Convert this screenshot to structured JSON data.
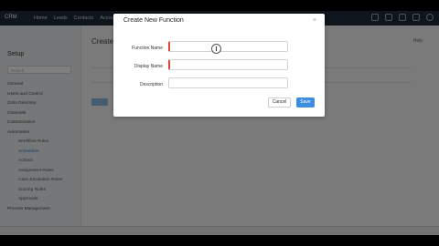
{
  "app": {
    "brand": "CRM",
    "nav": [
      "Home",
      "Leads",
      "Contacts",
      "Accounts"
    ]
  },
  "colors": {
    "accent": "#3d8ee0",
    "topbar": "#1c2a3a",
    "required": "#e0453a"
  },
  "sidebar": {
    "title": "Setup",
    "search_placeholder": "Search",
    "items": [
      {
        "label": "General",
        "sub": false
      },
      {
        "label": "Users and Control",
        "sub": false
      },
      {
        "label": "Zoho Directory",
        "sub": false
      },
      {
        "label": "Channels",
        "sub": false
      },
      {
        "label": "Customization",
        "sub": false
      },
      {
        "label": "Automation",
        "sub": false
      },
      {
        "label": "Workflow Rules",
        "sub": true
      },
      {
        "label": "Schedules",
        "sub": true
      },
      {
        "label": "Actions",
        "sub": true
      },
      {
        "label": "Assignment Rules",
        "sub": true
      },
      {
        "label": "Case Escalation Rules",
        "sub": true
      },
      {
        "label": "Scoring Rules",
        "sub": true
      },
      {
        "label": "Approvals",
        "sub": true
      },
      {
        "label": "Process Management",
        "sub": false
      }
    ]
  },
  "main": {
    "title": "Create",
    "help": "Help"
  },
  "dialog": {
    "title": "Create New Function",
    "close": "×",
    "function_name_label": "Function Name",
    "display_name_label": "Display Name",
    "description_label": "Description",
    "cancel": "Cancel",
    "save": "Save"
  }
}
